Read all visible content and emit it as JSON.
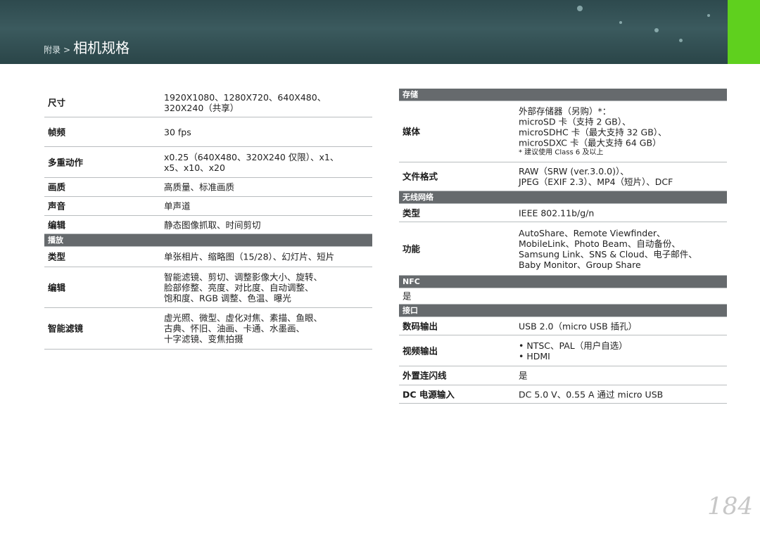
{
  "header": {
    "breadcrumb_small": "附录",
    "breadcrumb_sep": ">",
    "title": "相机规格"
  },
  "left": {
    "rows_top": [
      {
        "label": "尺寸",
        "values": [
          "1920X1080、1280X720、640X480、",
          "320X240（共享）"
        ]
      },
      {
        "label": "帧频",
        "values": [
          "30 fps"
        ]
      },
      {
        "label": "多重动作",
        "values": [
          "x0.25（640X480、320X240 仅限）、x1、",
          "x5、x10、x20"
        ]
      },
      {
        "label": "画质",
        "values": [
          "高质量、标准画质"
        ]
      },
      {
        "label": "声音",
        "values": [
          "单声道"
        ]
      },
      {
        "label": "编辑",
        "values": [
          "静态图像抓取、时间剪切"
        ]
      }
    ],
    "playback_section": "播放",
    "rows_playback": [
      {
        "label": "类型",
        "values": [
          "单张相片、缩略图（15/28）、幻灯片、短片"
        ]
      },
      {
        "label": "编辑",
        "values": [
          "智能滤镜、剪切、调整影像大小、旋转、",
          "脸部修整、亮度、对比度、自动调整、",
          "饱和度、RGB 调整、色温、曝光"
        ]
      },
      {
        "label": "智能滤镜",
        "values": [
          "虚光照、微型、虚化对焦、素描、鱼眼、",
          "古典、怀旧、油画、卡通、水墨画、",
          "十字滤镜、变焦拍摄"
        ]
      }
    ]
  },
  "right": {
    "storage_section": "存储",
    "media": {
      "label": "媒体",
      "values": [
        "外部存储器（另购）*：",
        "microSD 卡（支持 2 GB）、",
        "microSDHC 卡（最大支持 32 GB）、",
        "microSDXC 卡（最大支持 64 GB）"
      ],
      "note": "* 建议使用 Class 6 及以上"
    },
    "file_format": {
      "label": "文件格式",
      "values": [
        "RAW（SRW (ver.3.0.0)）、",
        "JPEG（EXIF 2.3）、MP4（短片）、DCF"
      ]
    },
    "wireless_section": "无线网络",
    "wireless_type": {
      "label": "类型",
      "values": [
        "IEEE 802.11b/g/n"
      ]
    },
    "wireless_function": {
      "label": "功能",
      "values": [
        "AutoShare、Remote Viewfinder、",
        "MobileLink、Photo Beam、自动备份、",
        "Samsung Link、SNS & Cloud、电子邮件、",
        "Baby Monitor、Group Share"
      ]
    },
    "nfc_section": "NFC",
    "nfc_value": "是",
    "interface_section": "接口",
    "digital_out": {
      "label": "数码输出",
      "values": [
        "USB 2.0（micro USB 插孔）"
      ]
    },
    "video_out": {
      "label": "视频输出",
      "values": [
        "NTSC、PAL（用户自选）",
        "HDMI"
      ]
    },
    "flash_sync": {
      "label": "外置连闪线",
      "values": [
        "是"
      ]
    },
    "dc_in": {
      "label": "DC 电源输入",
      "values": [
        "DC 5.0 V、0.55 A 通过 micro USB"
      ]
    }
  },
  "page_number": "184",
  "colors": {
    "banner": "#2e4a4e",
    "accent_green": "#5fd01e",
    "section_bar": "#666a6d"
  }
}
